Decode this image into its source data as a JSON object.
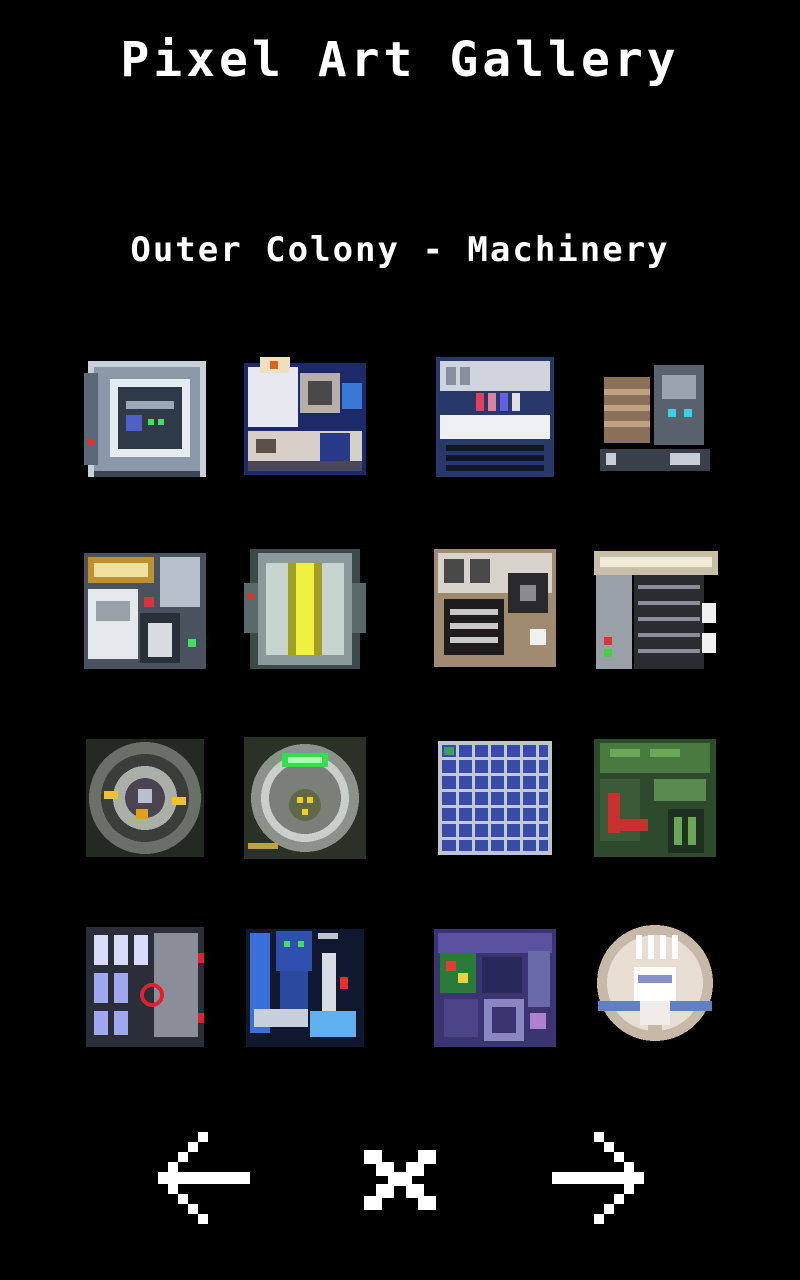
{
  "header": {
    "title": "Pixel Art Gallery",
    "subtitle": "Outer Colony - Machinery"
  },
  "gallery": {
    "tiles": [
      "machine-tile-1",
      "machine-tile-2",
      "machine-tile-3",
      "machine-tile-4",
      "machine-tile-5",
      "machine-tile-6",
      "machine-tile-7",
      "machine-tile-8",
      "machine-tile-9",
      "machine-tile-10",
      "machine-tile-11",
      "machine-tile-12",
      "machine-tile-13",
      "machine-tile-14",
      "machine-tile-15",
      "machine-tile-16"
    ]
  },
  "navigation": {
    "previous_icon": "arrow-left-icon",
    "close_icon": "close-icon",
    "next_icon": "arrow-right-icon"
  },
  "colors": {
    "background": "#000000",
    "text": "#ffffff"
  }
}
